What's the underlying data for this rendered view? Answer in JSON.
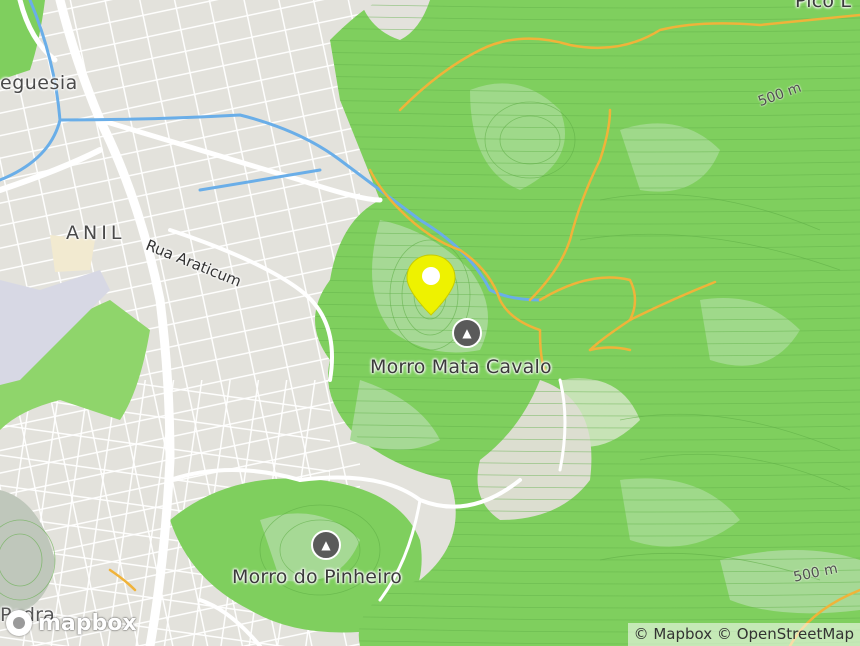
{
  "map": {
    "labels": {
      "freguesia": "eguesia",
      "anil": "ANIL",
      "rua_araticum": "Rua Araticum",
      "morro_mata_cavalo": "Morro Mata Cavalo",
      "morro_do_pinheiro": "Morro do Pinheiro",
      "pico": "Pico L",
      "contour_500_top": "500 m",
      "contour_500_bottom": "500 m",
      "bottom_left_partial": "Pedra"
    },
    "attribution": {
      "mapbox": "© Mapbox",
      "osm": "© OpenStreetMap"
    },
    "logo_text": "mapbox",
    "colors": {
      "forest": "#7fcf5e",
      "forest_light": "#a8dd86",
      "urban": "#e3e2dc",
      "road": "#ffffff",
      "trail": "#f0b33a",
      "river": "#6aaee8",
      "pin": "#eef200",
      "peak_icon": "#5a5a5a"
    },
    "icons": {
      "pin": "location-pin-icon",
      "peak": "mountain-peak-icon"
    }
  }
}
